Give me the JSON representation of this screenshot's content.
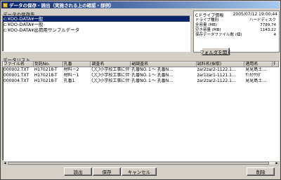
{
  "window": {
    "title": "データの保存・読出（実施される上の確認・部例）"
  },
  "folders": {
    "label": "データの保存先",
    "items": [
      "c:¥DO-DATA¥一般",
      "c:¥DO-DATA¥一般",
      "c:¥DO-DATA¥出荷用サンプルデータ"
    ],
    "selected_index": 0
  },
  "drive": {
    "title": "Cドライブ情報",
    "datetime": "2005/07/12 19:00:44",
    "rows": [
      {
        "label": "ドライブ種別",
        "unit": "",
        "value": "ハードディスク"
      },
      {
        "label": "全容量",
        "unit": "(MB)",
        "value": "7789.74"
      },
      {
        "label": "空き容量",
        "unit": "(MB)",
        "value": "1143.22"
      },
      {
        "label": "保存データファイル数",
        "unit": "(個)",
        "value": "4"
      }
    ],
    "open_folder_label": "フォルダを開く"
  },
  "data_list": {
    "label": "データリスト",
    "columns": [
      "ファイル名",
      "受託No.",
      "孔番",
      "調査名",
      "副調査名",
      "試料名(採取)",
      "適用名",
      "ﾀ"
    ],
    "rows": [
      [
        "000002.TXT",
        "H170218-T",
        "材料－2",
        "〇〇小学校工事に伴う地質…",
        "孔番NO.１～ 孔番N…",
        "zar2zar2-1122.1…",
        "見見島土…",
        ""
      ],
      [
        "000001.TXT",
        "H170218-T",
        "材料－1",
        "〇〇小学校工事に伴う地質…",
        "孔番NO.１～ 孔番N…",
        "zar1zar1-1121.1…",
        "ｻﾝｶｸｻｸﾀﾞ",
        ""
      ],
      [
        "000004.TXT",
        "H170218-T",
        "孔番1",
        "〇〇小学校工事に伴う地質…",
        "孔番NO.１～ 孔番N…",
        "zar2zar2-1122.1…",
        "見見島土…",
        ""
      ]
    ]
  },
  "buttons": {
    "read": "読出",
    "save": "保存",
    "cancel": "キャンセル",
    "delete": "削除"
  }
}
